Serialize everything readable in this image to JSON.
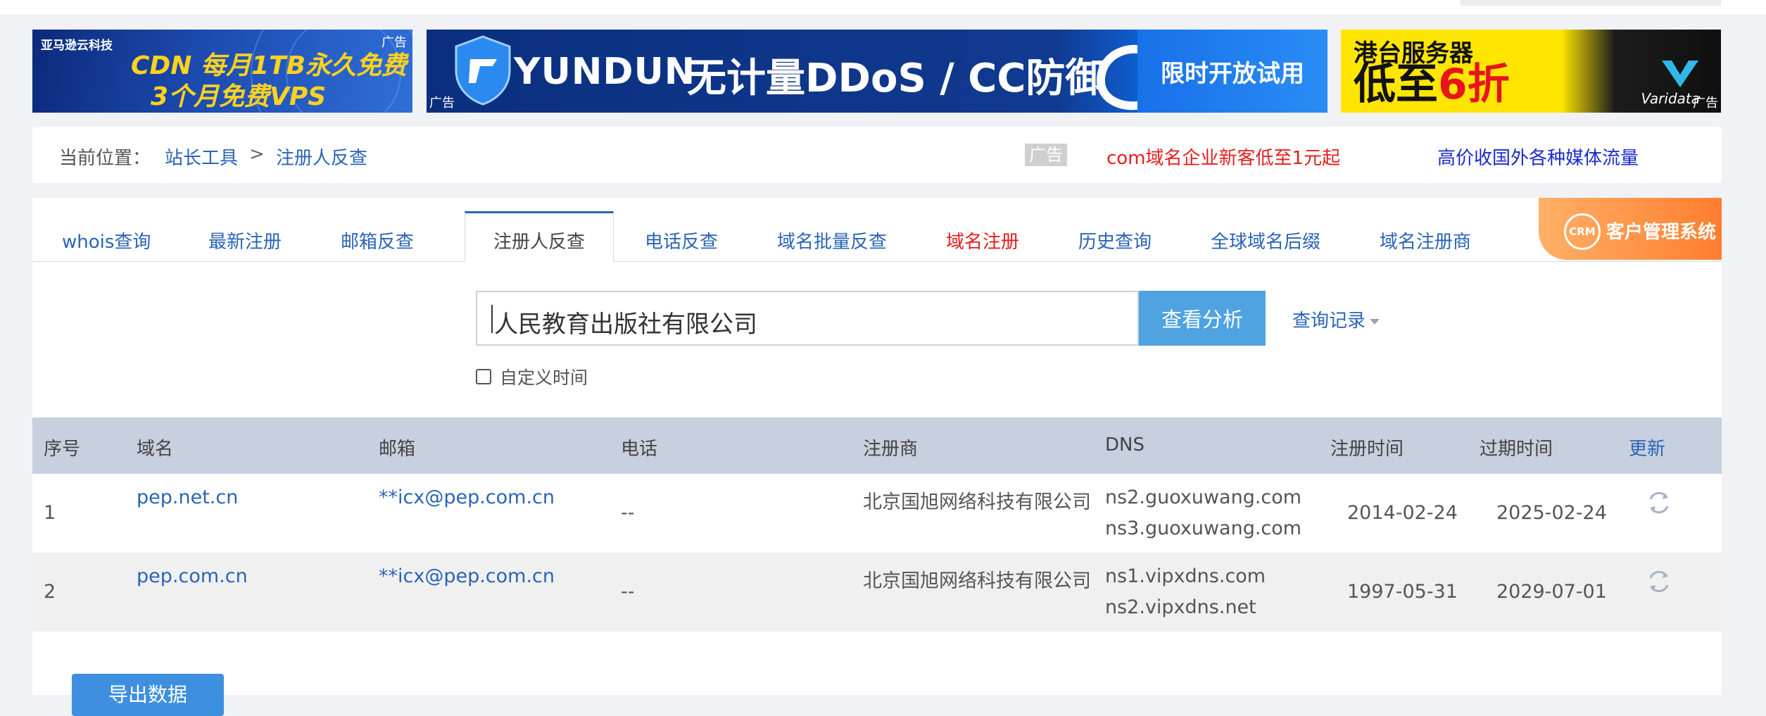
{
  "ads": {
    "ad1": {
      "brand": "亚马逊云科技",
      "line1": "CDN 每月1TB永久免费",
      "line2": "3个月免费VPS",
      "tag": "广告"
    },
    "ad2": {
      "logo": "YUNDUN",
      "headline": "无计量DDoS / CC防御",
      "cta": "限时开放试用",
      "tag": "广告"
    },
    "ad3": {
      "line1": "港台服务器",
      "line2_prefix": "低至",
      "line2_highlight": "6折",
      "brand": "Varidata",
      "tag": "广告"
    }
  },
  "breadcrumb": {
    "label": "当前位置：",
    "items": [
      "站长工具",
      "注册人反查"
    ],
    "separator": ">",
    "ad_tag": "广告",
    "promo1": "com域名企业新客低至1元起",
    "promo2": "高价收国外各种媒体流量"
  },
  "tabs": [
    {
      "label": "whois查询"
    },
    {
      "label": "最新注册"
    },
    {
      "label": "邮箱反查"
    },
    {
      "label": "注册人反查",
      "active": true
    },
    {
      "label": "电话反查"
    },
    {
      "label": "域名批量反查"
    },
    {
      "label": "域名注册",
      "highlight": true
    },
    {
      "label": "历史查询"
    },
    {
      "label": "全球域名后缀"
    },
    {
      "label": "域名注册商"
    }
  ],
  "crm": {
    "badge": "CRM",
    "label": "客户管理系统"
  },
  "search": {
    "value": "人民教育出版社有限公司",
    "button": "查看分析",
    "history": "查询记录",
    "custom_time": "自定义时间"
  },
  "table": {
    "headers": [
      "序号",
      "域名",
      "邮箱",
      "电话",
      "注册商",
      "DNS",
      "注册时间",
      "过期时间",
      "更新"
    ],
    "rows": [
      {
        "no": "1",
        "domain": "pep.net.cn",
        "email": "**icx@pep.com.cn",
        "phone": "--",
        "registrar": "北京国旭网络科技有限公司",
        "dns1": "ns2.guoxuwang.com",
        "dns2": "ns3.guoxuwang.com",
        "reg": "2014-02-24",
        "exp": "2025-02-24"
      },
      {
        "no": "2",
        "domain": "pep.com.cn",
        "email": "**icx@pep.com.cn",
        "phone": "--",
        "registrar": "北京国旭网络科技有限公司",
        "dns1": "ns1.vipxdns.com",
        "dns2": "ns2.vipxdns.net",
        "reg": "1997-05-31",
        "exp": "2029-07-01"
      }
    ]
  },
  "export_button": "导出数据",
  "colors": {
    "link": "#2a64b7",
    "button": "#4ea3e0",
    "header_bg": "#c8cfdf",
    "highlight": "#e61d1d"
  }
}
